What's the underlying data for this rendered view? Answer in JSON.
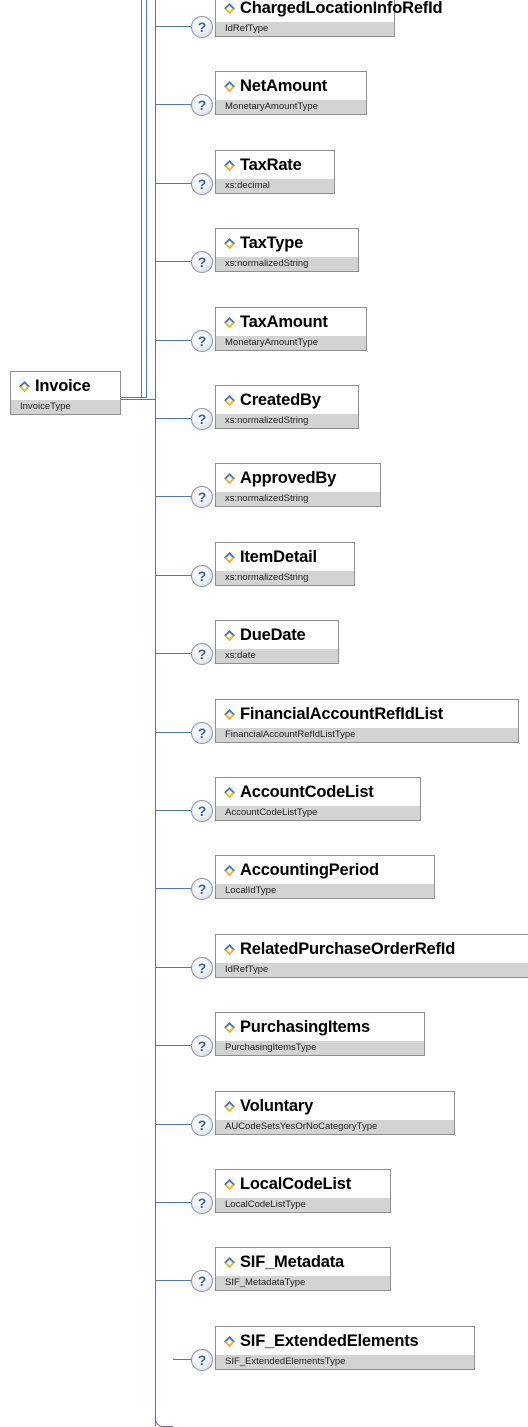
{
  "root": {
    "name": "Invoice",
    "type": "InvoiceType"
  },
  "help_glyph": "?",
  "elements": [
    {
      "name": "ChargedLocationInfoRefId",
      "type": "IdRefType"
    },
    {
      "name": "NetAmount",
      "type": "MonetaryAmountType"
    },
    {
      "name": "TaxRate",
      "type": "xs:decimal"
    },
    {
      "name": "TaxType",
      "type": "xs:normalizedString"
    },
    {
      "name": "TaxAmount",
      "type": "MonetaryAmountType"
    },
    {
      "name": "CreatedBy",
      "type": "xs:normalizedString"
    },
    {
      "name": "ApprovedBy",
      "type": "xs:normalizedString"
    },
    {
      "name": "ItemDetail",
      "type": "xs:normalizedString"
    },
    {
      "name": "DueDate",
      "type": "xs:date"
    },
    {
      "name": "FinancialAccountRefIdList",
      "type": "FinancialAccountRefIdListType"
    },
    {
      "name": "AccountCodeList",
      "type": "AccountCodeListType"
    },
    {
      "name": "AccountingPeriod",
      "type": "LocalIdType"
    },
    {
      "name": "RelatedPurchaseOrderRefId",
      "type": "IdRefType"
    },
    {
      "name": "PurchasingItems",
      "type": "PurchasingItemsType"
    },
    {
      "name": "Voluntary",
      "type": "AUCodeSetsYesOrNoCategoryType"
    },
    {
      "name": "LocalCodeList",
      "type": "LocalCodeListType"
    },
    {
      "name": "SIF_Metadata",
      "type": "SIF_MetadataType"
    },
    {
      "name": "SIF_ExtendedElements",
      "type": "SIF_ExtendedElementsType"
    }
  ],
  "colors": {
    "connector": "#4f77ad",
    "type_bar": "#d3d3d3",
    "border": "#8e8e8e",
    "diamond_top": "#3f6fb7",
    "diamond_bottom": "#f2b61a"
  }
}
